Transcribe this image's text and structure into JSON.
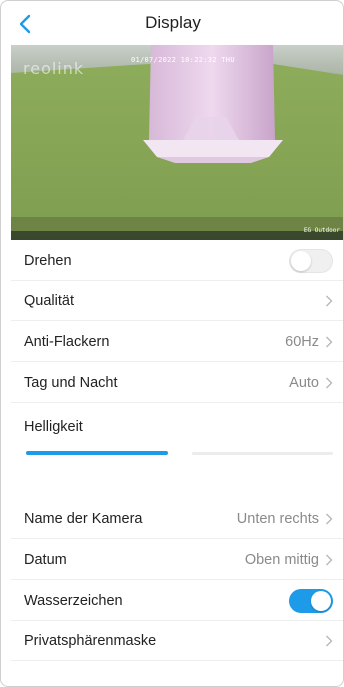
{
  "header": {
    "title": "Display",
    "back_icon": "chevron-left-icon"
  },
  "preview": {
    "logo": "reolink",
    "datetime": "01/07/2022 10:22:32 THU",
    "camera_name": "EG Outdoor"
  },
  "rows": {
    "drehen": {
      "label": "Drehen",
      "toggle": "off"
    },
    "qualitaet": {
      "label": "Qualität"
    },
    "anti_flackern": {
      "label": "Anti-Flackern",
      "value": "60Hz"
    },
    "tag_nacht": {
      "label": "Tag und Nacht",
      "value": "Auto"
    },
    "helligkeit": {
      "label": "Helligkeit",
      "level": 0.5
    },
    "name_kamera": {
      "label": "Name der Kamera",
      "value": "Unten rechts"
    },
    "datum": {
      "label": "Datum",
      "value": "Oben mittig"
    },
    "wasserzeichen": {
      "label": "Wasserzeichen",
      "toggle": "on"
    },
    "privat": {
      "label": "Privatsphärenmaske"
    }
  },
  "colors": {
    "accent": "#1e9be8",
    "chevron": "#b5b5b5",
    "value_text": "#8a8a8a"
  }
}
